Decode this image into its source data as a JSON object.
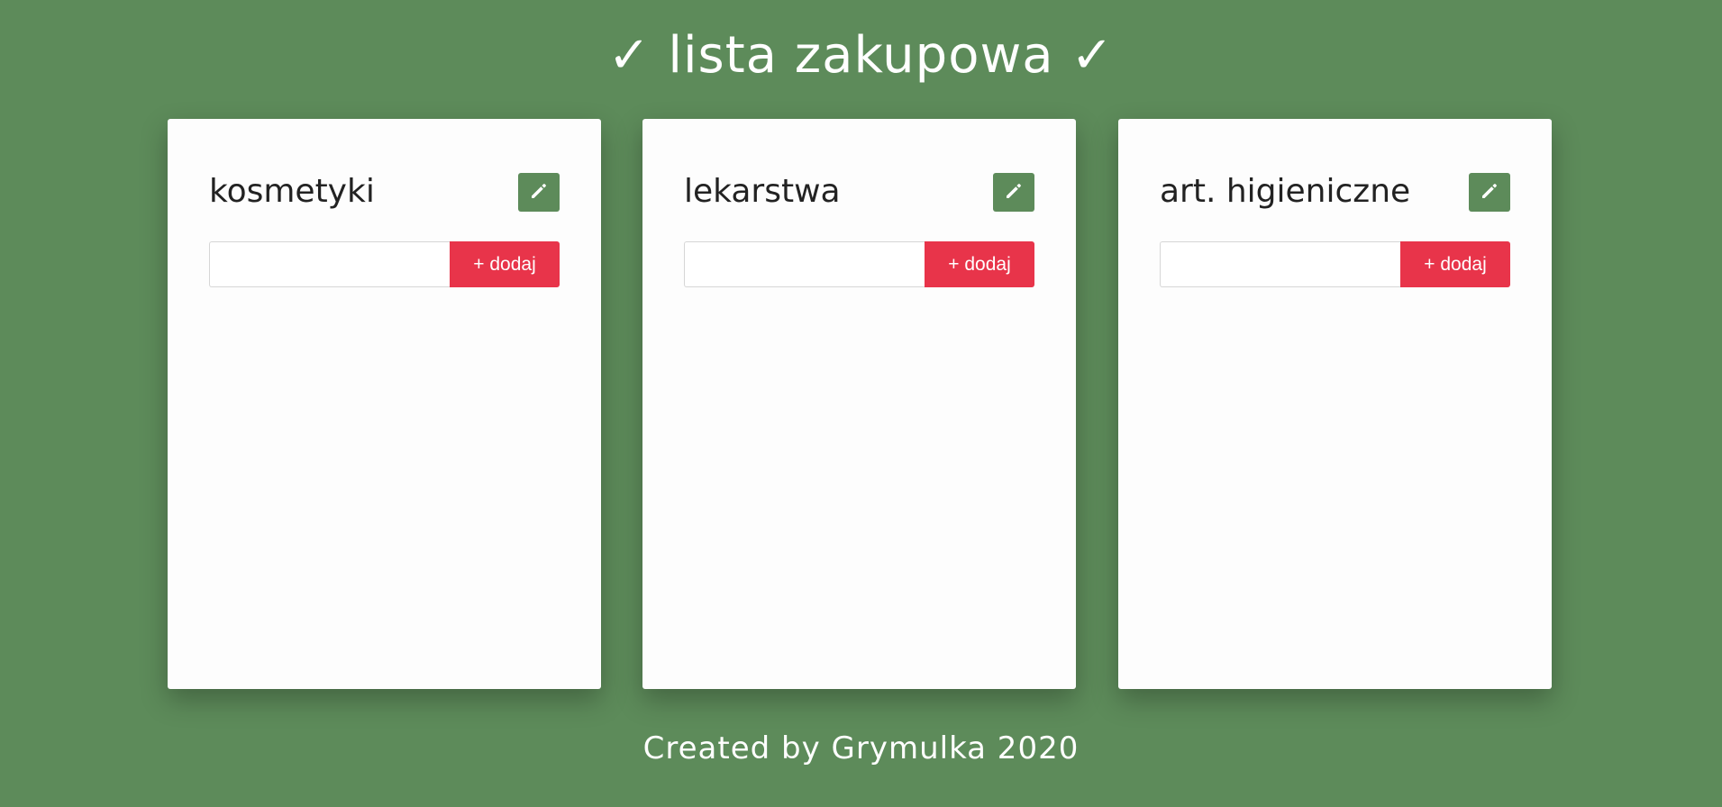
{
  "header": {
    "title": "✓ lista zakupowa ✓"
  },
  "lists": [
    {
      "title": "kosmetyki",
      "input_value": "",
      "add_label": "+ dodaj",
      "edit_icon": "pencil-icon"
    },
    {
      "title": "lekarstwa",
      "input_value": "",
      "add_label": "+ dodaj",
      "edit_icon": "pencil-icon"
    },
    {
      "title": "art. higieniczne",
      "input_value": "",
      "add_label": "+ dodaj",
      "edit_icon": "pencil-icon"
    }
  ],
  "footer": {
    "text": "Created by Grymulka 2020"
  },
  "colors": {
    "background": "#5d8b5a",
    "card": "#fdfdfd",
    "accent_button": "#e8344a",
    "edit_button": "#5d8b5a"
  }
}
